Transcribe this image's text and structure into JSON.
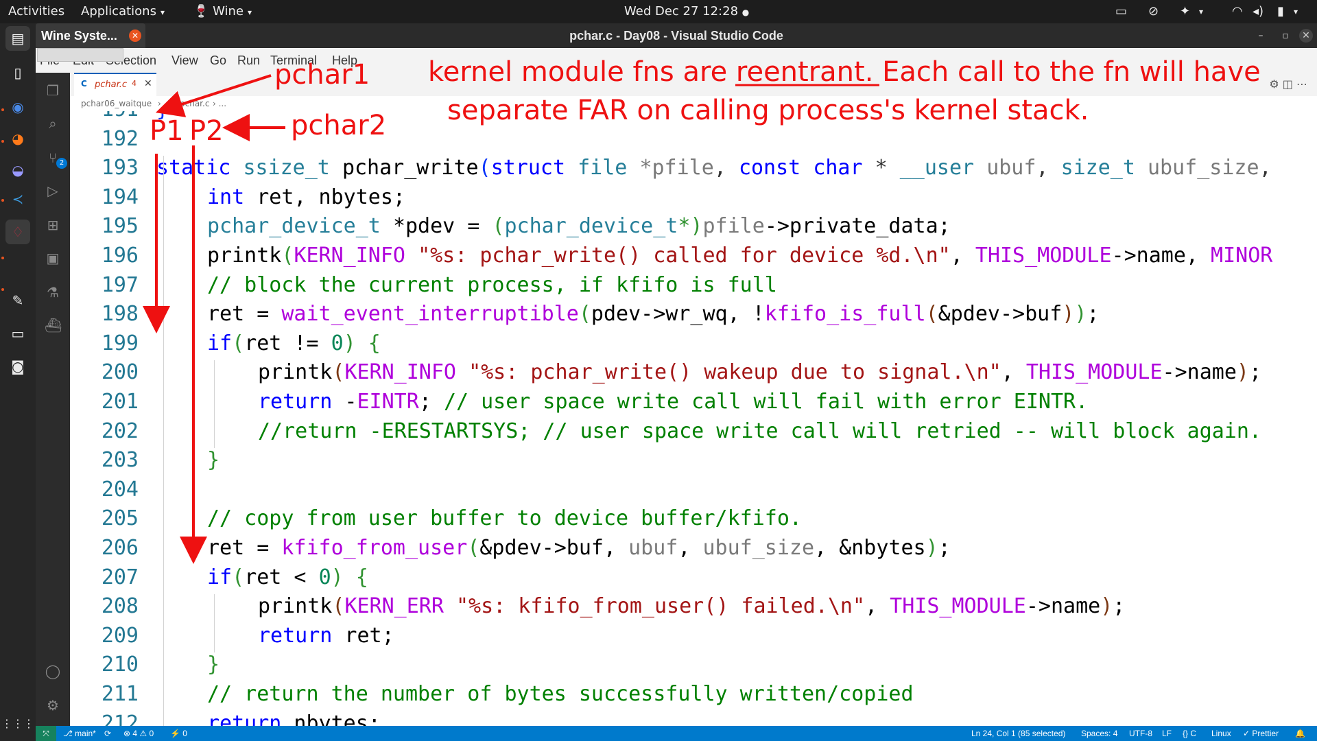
{
  "topbar": {
    "activities": "Activities",
    "applications": "Applications",
    "wine": "Wine",
    "clock": "Wed Dec 27  12:28",
    "caret": "▾",
    "dot": "●"
  },
  "wine_notification": {
    "label": "Wine Syste...",
    "close": "✕"
  },
  "window": {
    "title": "pchar.c - Day08 - Visual Studio Code",
    "minimize": "–",
    "maximize": "▫",
    "close": "✕"
  },
  "menubar": [
    "File",
    "Edit",
    "Selection",
    "View",
    "Go",
    "Run",
    "Terminal",
    "Help"
  ],
  "tab": {
    "lang": "C",
    "name": "pchar.c",
    "count": "4",
    "close": "✕"
  },
  "breadcrumb": {
    "folder": "pchar06_waitque",
    "sep": "›",
    "lang": "C",
    "file": "pchar.c",
    "tail": "› ..."
  },
  "editor_actions": "⚙  ◫  ⋯",
  "lines": [
    {
      "n": "191"
    },
    {
      "n": "192"
    },
    {
      "n": "193"
    },
    {
      "n": "194"
    },
    {
      "n": "195"
    },
    {
      "n": "196"
    },
    {
      "n": "197"
    },
    {
      "n": "198"
    },
    {
      "n": "199"
    },
    {
      "n": "200"
    },
    {
      "n": "201"
    },
    {
      "n": "202"
    },
    {
      "n": "203"
    },
    {
      "n": "204"
    },
    {
      "n": "205"
    },
    {
      "n": "206"
    },
    {
      "n": "207"
    },
    {
      "n": "208"
    },
    {
      "n": "209"
    },
    {
      "n": "210"
    },
    {
      "n": "211"
    },
    {
      "n": "212"
    }
  ],
  "code": {
    "l191": "}",
    "l193": [
      "static",
      "ssize_t",
      "pchar_write",
      "(",
      "struct",
      "file",
      "*pfile",
      ",",
      "const",
      "char",
      "*",
      "__user",
      "ubuf",
      ",",
      "size_t",
      "ubuf_size",
      ","
    ],
    "l194": [
      "int",
      "ret, nbytes;"
    ],
    "l195": [
      "pchar_device_t",
      "*pdev = ",
      "(",
      "pchar_device_t",
      "*)",
      "pfile",
      "->private_data;"
    ],
    "l196": [
      "printk",
      "(",
      "KERN_INFO",
      "\"%s: pchar_write() called for device %d.\\n\"",
      ", ",
      "THIS_MODULE",
      "->name, ",
      "MINOR"
    ],
    "l197": "// block the current process, if kfifo is full",
    "l198": [
      "ret = ",
      "wait_event_interruptible",
      "(",
      "pdev->wr_wq, !",
      "kfifo_is_full",
      "(",
      "&pdev->buf",
      ")",
      ")",
      ";"
    ],
    "l199": [
      "if",
      "(",
      "ret != ",
      "0",
      ")",
      " {"
    ],
    "l200": [
      "printk",
      "(",
      "KERN_INFO",
      "\"%s: pchar_write() wakeup due to signal.\\n\"",
      ", ",
      "THIS_MODULE",
      "->name",
      ")",
      ";"
    ],
    "l201": [
      "return",
      " -",
      "EINTR",
      "; ",
      "// user space write call will fail with error EINTR."
    ],
    "l202": "//return -ERESTARTSYS; // user space write call will retried -- will block again.",
    "l203": "}",
    "l205": "// copy from user buffer to device buffer/kfifo.",
    "l206": [
      "ret = ",
      "kfifo_from_user",
      "(",
      "&pdev->buf, ",
      "ubuf",
      ", ",
      "ubuf_size",
      ", &nbytes",
      ")",
      ";"
    ],
    "l207": [
      "if",
      "(",
      "ret < ",
      "0",
      ")",
      " {"
    ],
    "l208": [
      "printk",
      "(",
      "KERN_ERR",
      " \"%s: kfifo_from_user() failed.\\n\"",
      ", ",
      "THIS_MODULE",
      "->name",
      ")",
      ";"
    ],
    "l209": [
      "return",
      " ret;"
    ],
    "l210": "}",
    "l211": "// return the number of bytes successfully written/copied",
    "l212": [
      "return",
      " nbytes;"
    ]
  },
  "annotations": {
    "pchar1": "pchar1",
    "pchar2": "pchar2",
    "p1": "P1",
    "p2": "P2",
    "note_line1_a": "kernel module fns are",
    "note_line1_b": " reentrant.",
    "note_line1_c": " Each call to the fn will have",
    "note_line2": "separate FAR on calling process's kernel stack."
  },
  "statusbar": {
    "remote": "⤧",
    "branch": "⎇ main*",
    "sync": "⟳",
    "problems": "⊗ 4 ⚠ 0",
    "ports": "⚡ 0",
    "position": "Ln 24, Col 1 (85 selected)",
    "spaces": "Spaces: 4",
    "encoding": "UTF-8",
    "eol": "LF",
    "language": "{} C",
    "os": "Linux",
    "prettier": "✓ Prettier",
    "bell": "🔔"
  },
  "colors": {
    "annotation": "#ee1111",
    "statusbar": "#007acc",
    "accent": "#e95420"
  }
}
